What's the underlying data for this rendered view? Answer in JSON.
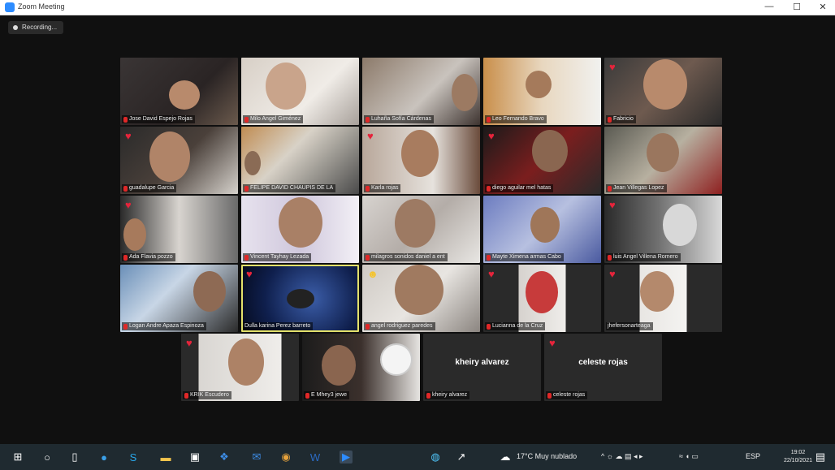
{
  "window": {
    "title": "Zoom Meeting",
    "minimize": "—",
    "maximize": "☐",
    "close": "✕"
  },
  "recording": {
    "label": "Recording..."
  },
  "participants": [
    {
      "name": "Jose David Espejo Rojas",
      "reaction": ""
    },
    {
      "name": "Milo Angel Giménez",
      "reaction": ""
    },
    {
      "name": "Luhaña Sofía Cárdenas",
      "reaction": ""
    },
    {
      "name": "Leo Fernando Bravo",
      "reaction": ""
    },
    {
      "name": "Fabricio",
      "reaction": "heart"
    },
    {
      "name": "guadalupe Garcia",
      "reaction": "heart"
    },
    {
      "name": "FELIPE DAVID CHAUPIS DE LA",
      "reaction": ""
    },
    {
      "name": "Karla rojas",
      "reaction": "heart"
    },
    {
      "name": "diego aguilar mel hatas",
      "reaction": "heart"
    },
    {
      "name": "Jean Villegas Lopez",
      "reaction": ""
    },
    {
      "name": "Ada Flavia pozzo",
      "reaction": "heart"
    },
    {
      "name": "Vincent Tayhay Lezada",
      "reaction": ""
    },
    {
      "name": "milagros sonidos daniel a ent",
      "reaction": ""
    },
    {
      "name": "Mayte Ximena armas Cabo",
      "reaction": ""
    },
    {
      "name": "luis Angel Villena Romero",
      "reaction": "heart"
    },
    {
      "name": "Logan Andre Apaza Espinoza",
      "reaction": ""
    },
    {
      "name": "Dulla karina Perez barreto",
      "reaction": "heart"
    },
    {
      "name": "angel rodriguez paredes",
      "reaction": "smile"
    },
    {
      "name": "Lucianna de la Cruz",
      "reaction": "heart"
    },
    {
      "name": "jhefersonarteaga",
      "reaction": "heart"
    },
    {
      "name": "KRIK Escudero",
      "reaction": "heart"
    },
    {
      "name": "E Mhey3 jewe",
      "reaction": ""
    },
    {
      "name": "kheiry alvarez",
      "reaction": "",
      "center_name": "kheiry alvarez"
    },
    {
      "name": "celeste rojas",
      "reaction": "heart",
      "center_name": "celeste rojas"
    }
  ],
  "taskbar": {
    "weather": "17°C Muy nublado",
    "language": "ESP",
    "time": "19:02",
    "date": "22/10/2021",
    "icons": [
      "windows-start-icon",
      "search-icon",
      "task-view-icon",
      "edge-browser-icon",
      "skype-icon",
      "file-explorer-icon",
      "store-icon",
      "dropbox-icon",
      "mail-icon",
      "chrome-icon",
      "word-icon",
      "zoom-icon"
    ]
  },
  "colors": {
    "speaker_border": "#e3e16b",
    "heart": "#e5243b",
    "mic_muted": "#e02828"
  }
}
